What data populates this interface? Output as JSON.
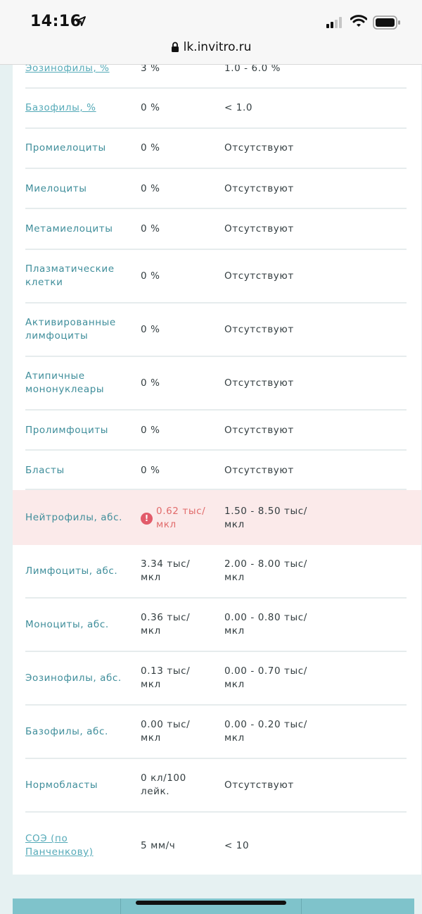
{
  "status_bar": {
    "time": "14:16",
    "url": "lk.invitro.ru"
  },
  "rows": [
    {
      "name": "Эозинофилы, %",
      "value": "3 %",
      "ref": "1.0 - 6.0 %",
      "link": true
    },
    {
      "name": "Базофилы, %",
      "value": "0 %",
      "ref": "< 1.0",
      "link": true
    },
    {
      "name": "Промиелоциты",
      "value": "0 %",
      "ref": "Отсутствуют"
    },
    {
      "name": "Миелоциты",
      "value": "0 %",
      "ref": "Отсутствуют"
    },
    {
      "name": "Метамиелоциты",
      "value": "0 %",
      "ref": "Отсутствуют"
    },
    {
      "name": "Плазматические клетки",
      "value": "0 %",
      "ref": "Отсутствуют"
    },
    {
      "name": "Активированные лимфоциты",
      "value": "0 %",
      "ref": "Отсутствуют"
    },
    {
      "name": "Атипичные мононуклеары",
      "value": "0 %",
      "ref": "Отсутствуют"
    },
    {
      "name": "Пролимфоциты",
      "value": "0 %",
      "ref": "Отсутствуют"
    },
    {
      "name": "Бласты",
      "value": "0 %",
      "ref": "Отсутствуют"
    },
    {
      "name": "Нейтрофилы, абс.",
      "value": "0.62 тыс/мкл",
      "ref": "1.50 - 8.50 тыс/мкл",
      "alert": true,
      "alert_icon": "!"
    },
    {
      "name": "Лимфоциты, абс.",
      "value": "3.34 тыс/мкл",
      "ref": "2.00 - 8.00 тыс/мкл"
    },
    {
      "name": "Моноциты, абс.",
      "value": "0.36 тыс/мкл",
      "ref": "0.00 - 0.80 тыс/мкл"
    },
    {
      "name": "Эозинофилы, абс.",
      "value": "0.13 тыс/мкл",
      "ref": "0.00 - 0.70 тыс/мкл"
    },
    {
      "name": "Базофилы, абс.",
      "value": "0.00 тыс/мкл",
      "ref": "0.00 - 0.20 тыс/мкл"
    },
    {
      "name": "Нормобласты",
      "value": "0 кл/100 лейк.",
      "ref": "Отсутствуют"
    },
    {
      "name": "СОЭ (по Панченкову)",
      "value": "5 мм/ч",
      "ref": "< 10",
      "link": true
    }
  ],
  "colors": {
    "accent": "#3e8d9a",
    "link": "#55aab8",
    "alert_bg": "#fbeaea",
    "alert_text": "#e16b6b",
    "page_bg": "#e6f1f2"
  }
}
